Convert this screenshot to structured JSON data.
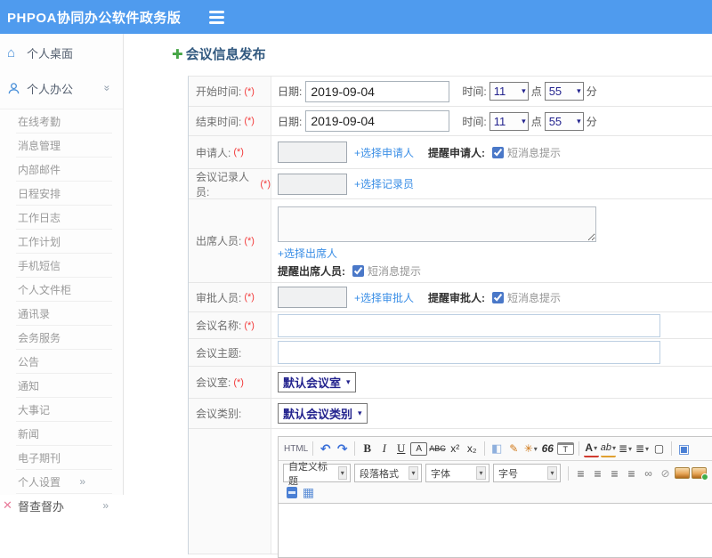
{
  "topbar": {
    "title": "PHPOA协同办公软件政务版"
  },
  "sidebar": {
    "desktop": "个人桌面",
    "office": "个人办公",
    "sub_items": [
      "在线考勤",
      "消息管理",
      "内部邮件",
      "日程安排",
      "工作日志",
      "工作计划",
      "手机短信",
      "个人文件柜",
      "通讯录",
      "会务服务",
      "公告",
      "通知",
      "大事记",
      "新闻",
      "电子期刊",
      "个人设置"
    ],
    "supervise": "督查督办"
  },
  "page": {
    "title": "会议信息发布"
  },
  "form": {
    "required_mark": "(*)",
    "rows": {
      "start_time": {
        "label": "开始时间:",
        "date_label": "日期:",
        "date_value": "2019-09-04",
        "time_label": "时间:",
        "hour": "11",
        "hour_unit": "点",
        "minute": "55",
        "minute_unit": "分"
      },
      "end_time": {
        "label": "结束时间:",
        "date_label": "日期:",
        "date_value": "2019-09-04",
        "time_label": "时间:",
        "hour": "11",
        "hour_unit": "点",
        "minute": "55",
        "minute_unit": "分"
      },
      "applicant": {
        "label": "申请人:",
        "link": "+选择申请人",
        "remind_label": "提醒申请人:",
        "sms": "短消息提示"
      },
      "recorder": {
        "label": "会议记录人员:",
        "link": "+选择记录员"
      },
      "attendees": {
        "label": "出席人员:",
        "link": "+选择出席人",
        "remind_label": "提醒出席人员:",
        "sms": "短消息提示"
      },
      "approver": {
        "label": "审批人员:",
        "link": "+选择审批人",
        "remind_label": "提醒审批人:",
        "sms": "短消息提示"
      },
      "meeting_name": {
        "label": "会议名称:"
      },
      "meeting_subject": {
        "label": "会议主题:"
      },
      "meeting_room": {
        "label": "会议室:",
        "value": "默认会议室"
      },
      "meeting_type": {
        "label": "会议类别:",
        "value": "默认会议类别"
      }
    }
  },
  "editor": {
    "selects": {
      "title": "自定义标题",
      "paragraph": "段落格式",
      "font": "字体",
      "size": "字号"
    }
  },
  "icons": {
    "home": "⌂",
    "plus": "✚",
    "double_chevron": "»",
    "supervise_x": "✕",
    "caret": "▾",
    "html": "HTML",
    "undo": "↶",
    "redo": "↷",
    "bold": "B",
    "italic": "I",
    "underline": "U",
    "box_a": "A",
    "strike": "ABC",
    "sup": "x²",
    "sub": "x₂",
    "eraser": "◧",
    "brush": "✎",
    "painter": "✳",
    "quote": "66",
    "paste": "T",
    "fontcolor": "A",
    "highlight": "ab",
    "ol": "≣",
    "ul": "≣",
    "page": "▢",
    "fullscreen": "▣",
    "align": "≡",
    "link": "∞",
    "unlink": "⊘",
    "table": "▦"
  },
  "colors": {
    "topbar": "#4f9bee",
    "accent_blue": "#4a90d9",
    "link": "#3a8ee6",
    "required": "#f23b3b",
    "navy_select": "#23238e",
    "title": "#335a80"
  }
}
